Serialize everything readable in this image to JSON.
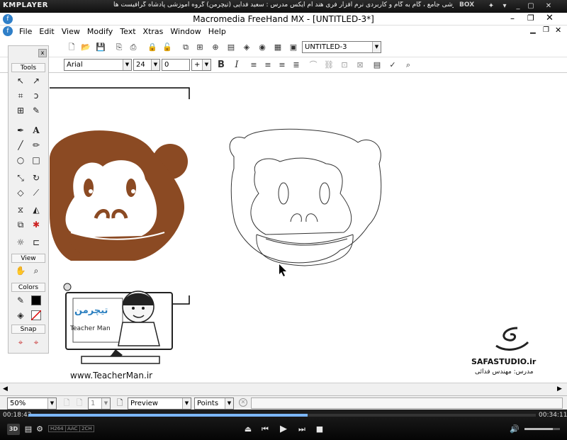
{
  "player": {
    "logo": "KMPLAYER",
    "marquee": "مجموعه آموزشی جامع ، گام به گام و کاربردی نرم افزار فری هند ام ایکس   مدرس : سعید فدایی (تیچرمن) گروه آموزشی پادشاه گرافیست ها",
    "box_label": "BOX",
    "time_elapsed": "00:18:42",
    "time_total": "00:34:11",
    "progress": 0.55,
    "volume": 0.8,
    "tags": [
      "H264",
      "AAC",
      "2CH"
    ],
    "badge_3d": "3D"
  },
  "app": {
    "title": "Macromedia FreeHand MX - [UNTITLED-3*]",
    "menu": [
      "File",
      "Edit",
      "View",
      "Modify",
      "Text",
      "Xtras",
      "Window",
      "Help"
    ],
    "document_combo": "UNTITLED-3",
    "font_name": "Arial",
    "font_size": "24",
    "leading": "0",
    "leading_mode": "+"
  },
  "panels": {
    "tools": "Tools",
    "view": "View",
    "colors": "Colors",
    "snap": "Snap"
  },
  "status": {
    "zoom": "50%",
    "page_number": "1",
    "preview_mode": "Preview",
    "units": "Points"
  },
  "watermarks": {
    "teacherman_url": "www.TeacherMan.ir",
    "teacherman_logo": "تیچرمن",
    "teacherman_en": "Teacher Man",
    "safa": "SAFASTUDIO.ir",
    "instructor": "مدرس: مهندس فدائی"
  },
  "colors": {
    "monkey_brown": "#8b4a23",
    "accent_blue": "#7cb7ff"
  }
}
